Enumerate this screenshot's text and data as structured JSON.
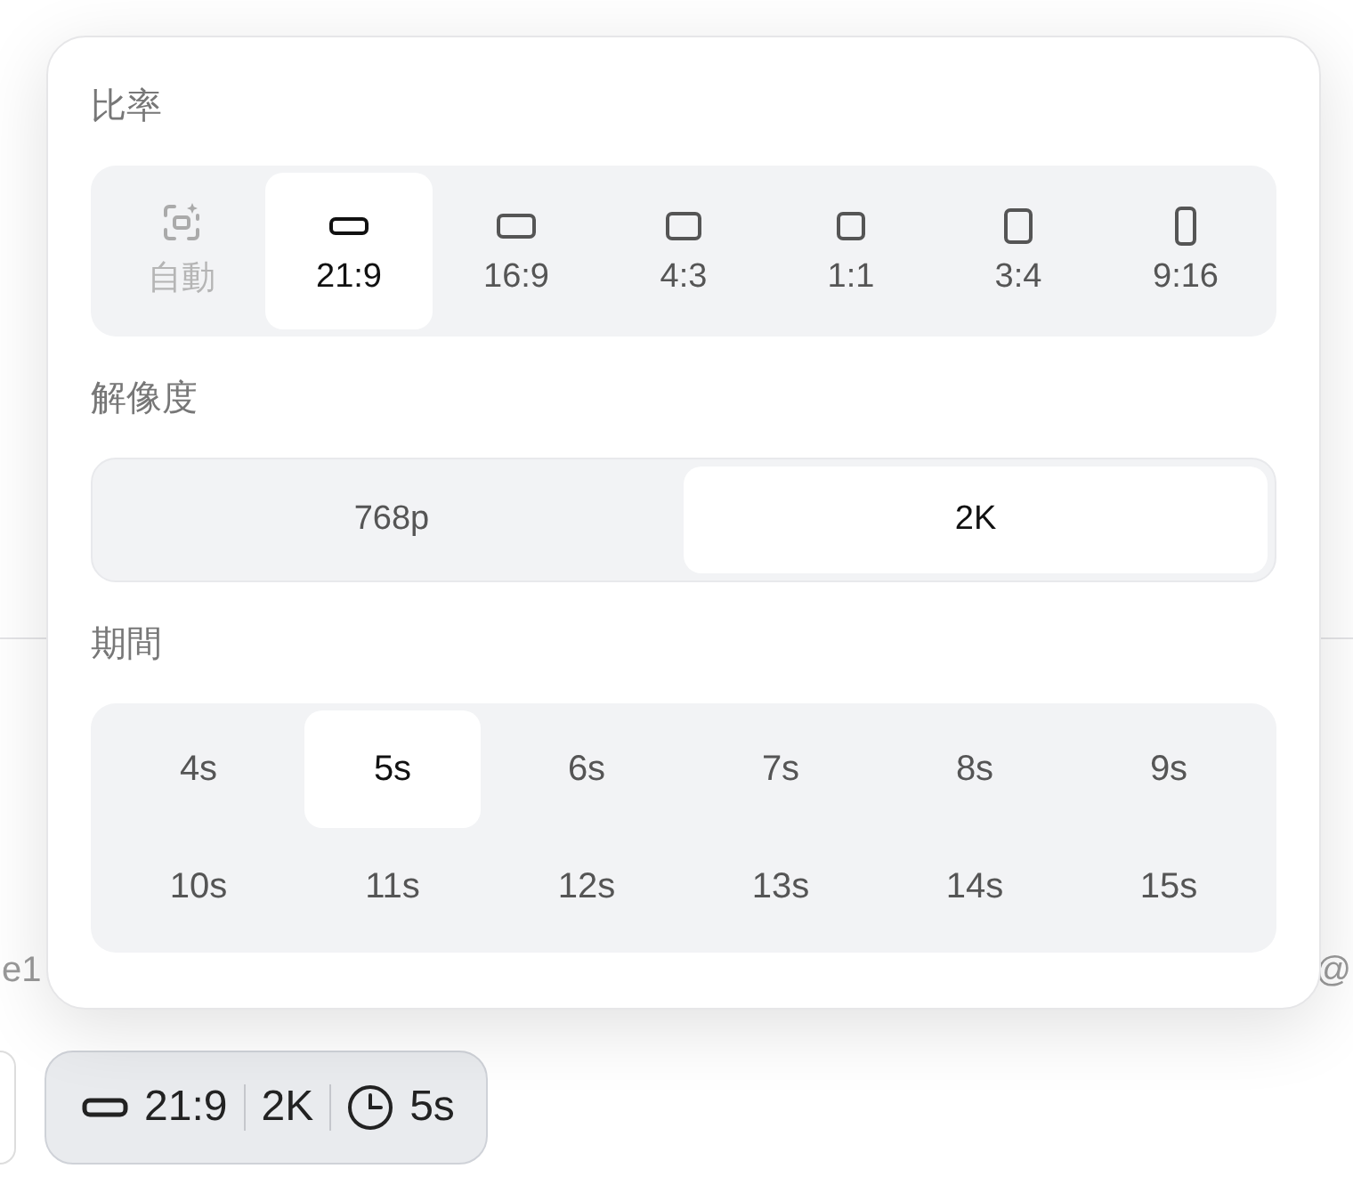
{
  "background": {
    "left_text": "e1",
    "right_text": "@"
  },
  "popup": {
    "ratio": {
      "title": "比率",
      "options": [
        {
          "kind": "auto",
          "label": "自動",
          "selected": false,
          "disabled": true
        },
        {
          "kind": "ratio",
          "label": "21:9",
          "selected": true,
          "disabled": false
        },
        {
          "kind": "ratio",
          "label": "16:9",
          "selected": false,
          "disabled": false
        },
        {
          "kind": "ratio",
          "label": "4:3",
          "selected": false,
          "disabled": false
        },
        {
          "kind": "ratio",
          "label": "1:1",
          "selected": false,
          "disabled": false
        },
        {
          "kind": "ratio",
          "label": "3:4",
          "selected": false,
          "disabled": false
        },
        {
          "kind": "ratio",
          "label": "9:16",
          "selected": false,
          "disabled": false
        }
      ]
    },
    "resolution": {
      "title": "解像度",
      "options": [
        {
          "label": "768p",
          "selected": false
        },
        {
          "label": "2K",
          "selected": true
        }
      ]
    },
    "duration": {
      "title": "期間",
      "options": [
        {
          "label": "4s",
          "selected": false
        },
        {
          "label": "5s",
          "selected": true
        },
        {
          "label": "6s",
          "selected": false
        },
        {
          "label": "7s",
          "selected": false
        },
        {
          "label": "8s",
          "selected": false
        },
        {
          "label": "9s",
          "selected": false
        },
        {
          "label": "10s",
          "selected": false
        },
        {
          "label": "11s",
          "selected": false
        },
        {
          "label": "12s",
          "selected": false
        },
        {
          "label": "13s",
          "selected": false
        },
        {
          "label": "14s",
          "selected": false
        },
        {
          "label": "15s",
          "selected": false
        }
      ]
    }
  },
  "summary": {
    "ratio": "21:9",
    "resolution": "2K",
    "duration": "5s"
  }
}
